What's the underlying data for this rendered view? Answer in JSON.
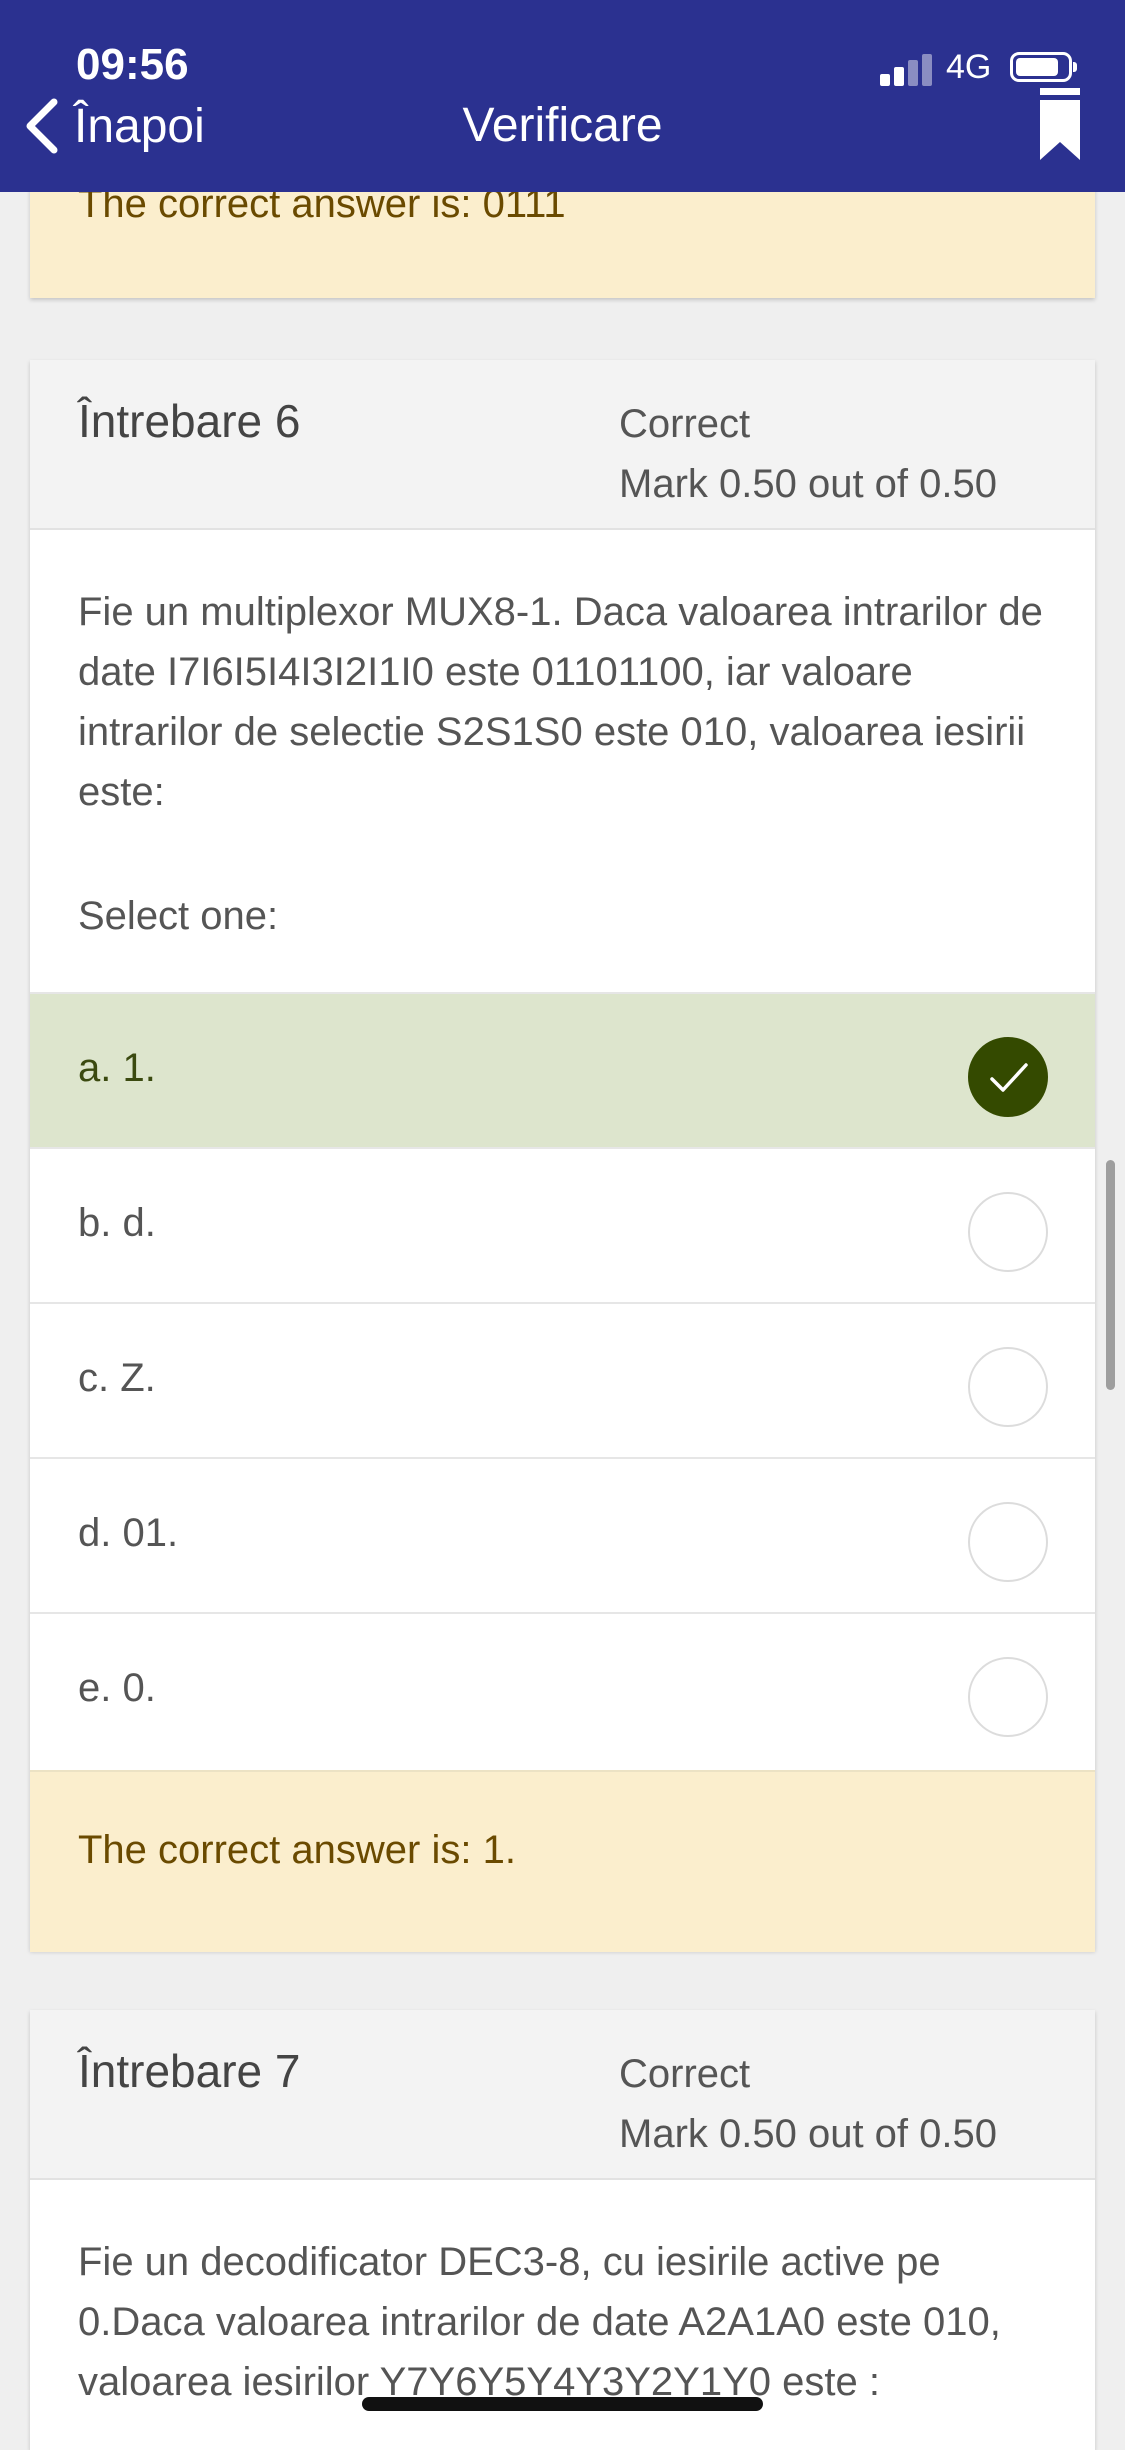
{
  "status_bar": {
    "time": "09:56",
    "network": "4G"
  },
  "nav": {
    "back_label": "Înapoi",
    "title": "Verificare"
  },
  "prev_feedback": "The correct answer is: 0111",
  "questions": [
    {
      "number": "Întrebare 6",
      "state": "Correct",
      "mark": "Mark 0.50 out of 0.50",
      "text": "Fie un multiplexor MUX8-1. Daca valoarea intrarilor de date I7I6I5I4I3I2I1I0 este 01101100, iar valoare intrarilor de selectie S2S1S0 este 010, valoarea iesirii este:",
      "prompt": "Select one:",
      "options": [
        "a. 1.",
        "b. d.",
        "c. Z.",
        "d. 01.",
        "e. 0."
      ],
      "selected_index": 0,
      "feedback": "The correct answer is: 1."
    },
    {
      "number": "Întrebare 7",
      "state": "Correct",
      "mark": "Mark 0.50 out of 0.50",
      "text": "Fie un decodificator DEC3-8, cu iesirile active pe 0.Daca valoarea intrarilor de date A2A1A0 este 010, valoarea iesirilor Y7Y6Y5Y4Y3Y2Y1Y0 este :"
    }
  ],
  "colors": {
    "header": "#2b3190",
    "selected_option": "#dde5cd",
    "check": "#344a00",
    "feedback": "#fbeecd"
  }
}
